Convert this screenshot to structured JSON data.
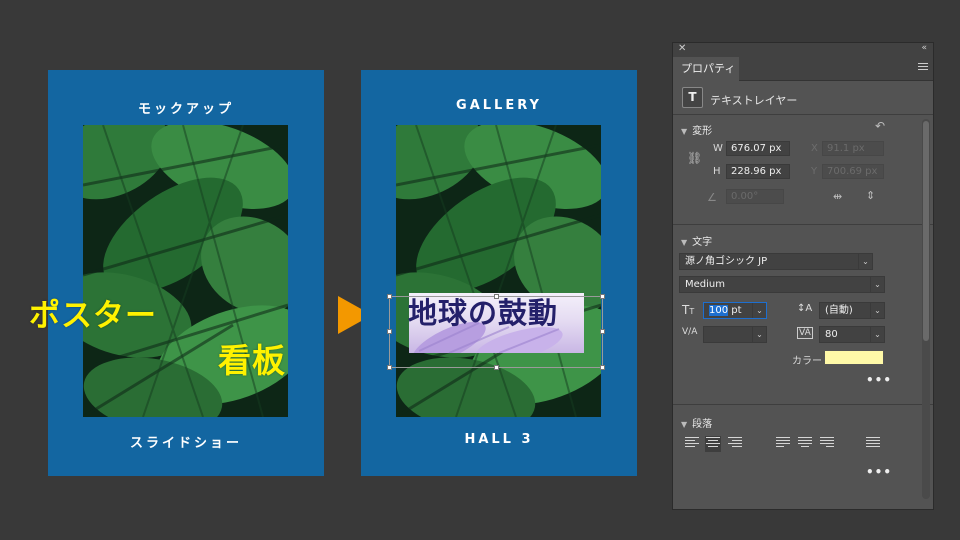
{
  "left_poster": {
    "title": "モックアップ",
    "footer": "スライドショー",
    "overlay_line1": "ポスター",
    "overlay_line2": "看板"
  },
  "right_poster": {
    "title": "GALLERY",
    "footer": "HALL 3",
    "overlay_text": "地球の鼓動"
  },
  "arrow_color": "#f39800",
  "panel": {
    "tab": "プロパティ",
    "layer_type": "テキストレイヤー",
    "transform": {
      "header": "変形",
      "w_label": "W",
      "w_value": "676.07 px",
      "h_label": "H",
      "h_value": "228.96 px",
      "x_label": "X",
      "x_value": "91.1 px",
      "y_label": "Y",
      "y_value": "700.69 px",
      "angle_value": "0.00°"
    },
    "character": {
      "header": "文字",
      "font_family": "源ノ角ゴシック JP",
      "font_style": "Medium",
      "font_size": "100",
      "font_size_unit": " pt",
      "leading": "(自動)",
      "kerning": "",
      "tracking": "80",
      "color_label": "カラー",
      "color_value": "#fff9a8"
    },
    "paragraph": {
      "header": "段落"
    }
  }
}
